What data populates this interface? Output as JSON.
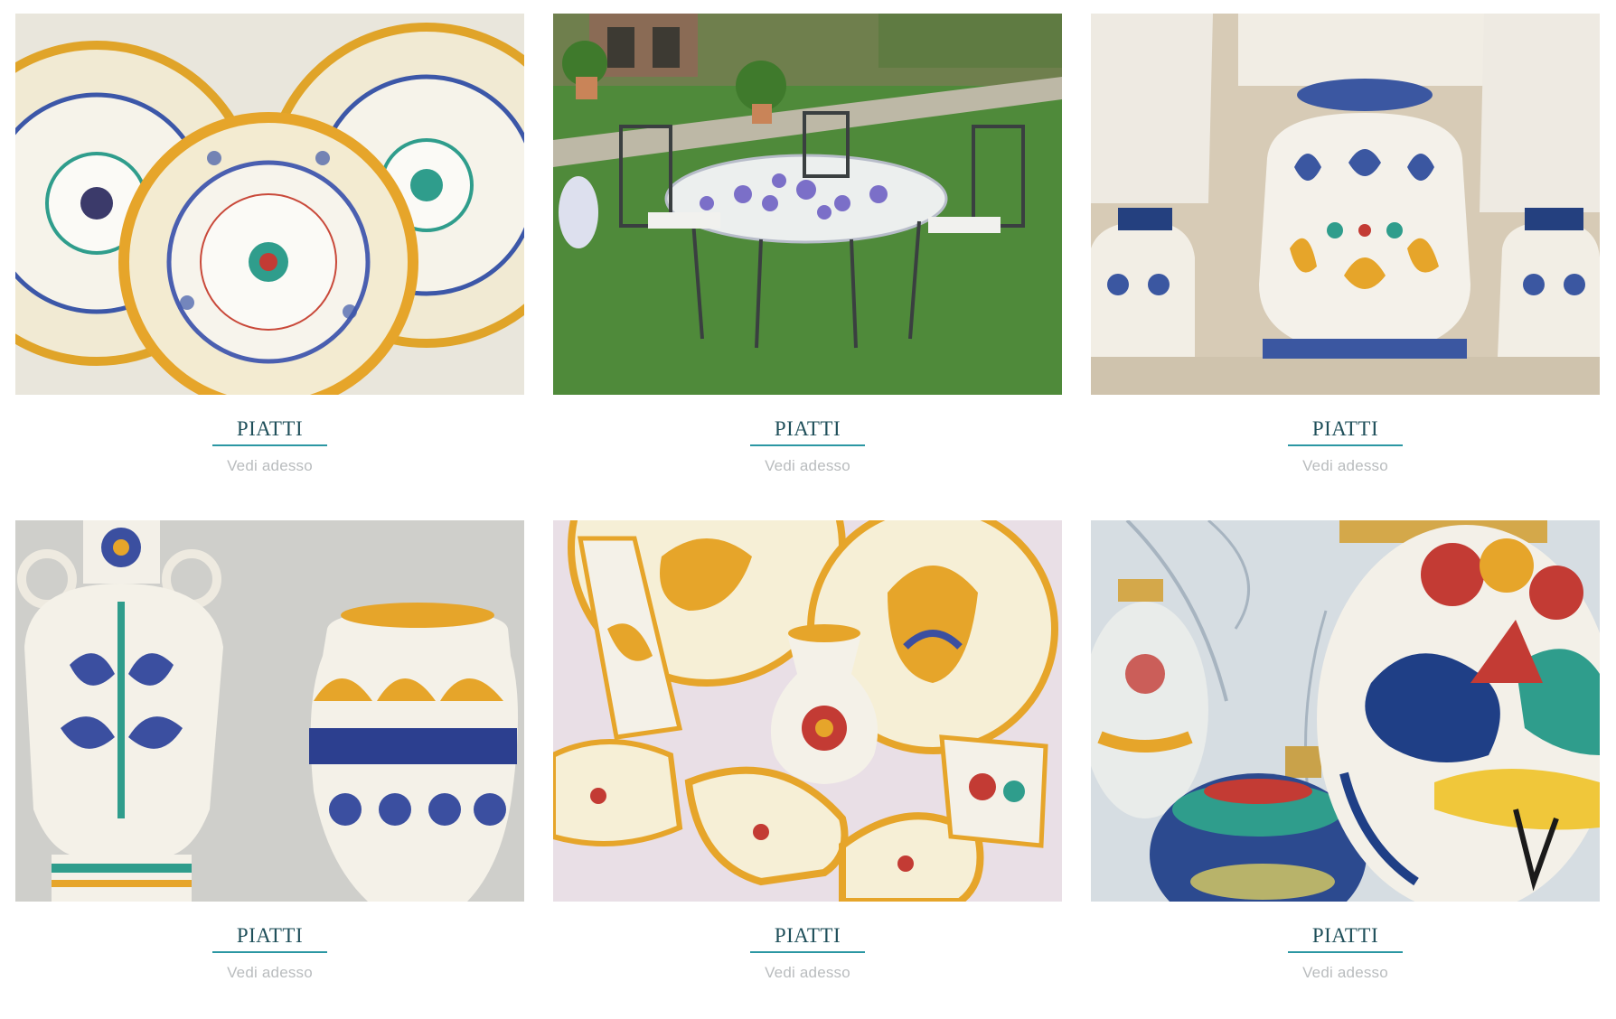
{
  "products": [
    {
      "title": "PIATTI",
      "cta": "Vedi adesso",
      "image_icon": "decorated-plates-image"
    },
    {
      "title": "PIATTI",
      "cta": "Vedi adesso",
      "image_icon": "garden-table-image"
    },
    {
      "title": "PIATTI",
      "cta": "Vedi adesso",
      "image_icon": "ceramic-lamp-image"
    },
    {
      "title": "PIATTI",
      "cta": "Vedi adesso",
      "image_icon": "ceramic-vases-image"
    },
    {
      "title": "PIATTI",
      "cta": "Vedi adesso",
      "image_icon": "rooster-ceramics-image"
    },
    {
      "title": "PIATTI",
      "cta": "Vedi adesso",
      "image_icon": "christmas-ornaments-image"
    }
  ],
  "colors": {
    "title": "#1f4f5a",
    "underline": "#2b97a3",
    "cta": "#b9bcbe"
  }
}
